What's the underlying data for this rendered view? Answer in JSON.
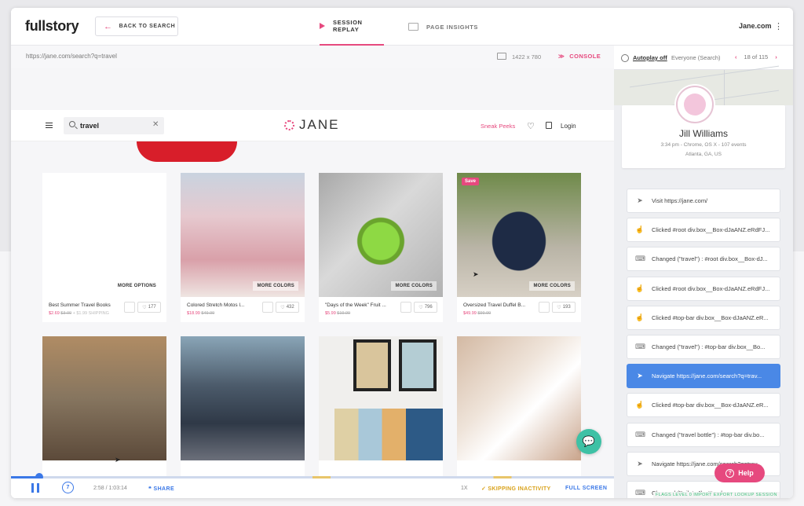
{
  "app": {
    "logo": "fullstory",
    "back_label": "BACK TO SEARCH",
    "tabs": [
      {
        "label": "SESSION REPLAY",
        "active": true
      },
      {
        "label": "PAGE INSIGHTS",
        "active": false
      }
    ],
    "site_name": "Jane.com",
    "kebab": "⋮"
  },
  "player": {
    "url": "https://jane.com/search?q=travel",
    "resolution": "1422 x 780",
    "console_label": "CONSOLE"
  },
  "site": {
    "search_value": "travel",
    "brand": "JANE",
    "sneak_peeks": "Sneak Peeks",
    "login": "Login",
    "products": [
      {
        "title": "Best Summer Travel Books",
        "price": "$2.69",
        "old_price": "$3.00",
        "extra": "+ $1.99 SHIPPING",
        "likes": "177",
        "overlay": "MORE OPTIONS",
        "img": "img1"
      },
      {
        "title": "Colored Stretch Motos l...",
        "price": "$18.99",
        "old_price": "$49.99",
        "extra": "",
        "likes": "432",
        "overlay": "MORE COLORS",
        "img": "img2"
      },
      {
        "title": "\"Days of the Week\" Fruit ...",
        "price": "$5.99",
        "old_price": "$19.99",
        "extra": "",
        "likes": "796",
        "overlay": "MORE COLORS",
        "img": "img3"
      },
      {
        "title": "Oversized Travel Duffel B...",
        "price": "$49.99",
        "old_price": "$99.99",
        "extra": "",
        "likes": "193",
        "overlay": "MORE COLORS",
        "img": "img4",
        "badge": "Save"
      }
    ],
    "chat_icon": "💬"
  },
  "controls": {
    "time": "2:58 / 1:03:14",
    "share": "SHARE",
    "speed": "1X",
    "skipping": "SKIPPING INACTIVITY",
    "fullscreen": "FULL SCREEN",
    "skip_seconds": "7",
    "progress_fraction": 0.047
  },
  "panel": {
    "autoplay": "Autoplay off",
    "segment": "Everyone (Search)",
    "pager": "18 of 115",
    "user": {
      "name": "Jill Williams",
      "meta": "3:34 pm - Chrome, OS X - 107 events",
      "location": "Atlanta,  GA,  US"
    },
    "events": [
      {
        "icon": "navigate-icon",
        "glyph": "➤",
        "text": "Visit https://jane.com/",
        "active": false
      },
      {
        "icon": "click-icon",
        "glyph": "☝",
        "text": "Clicked #root div.box__Box-dJaANZ.eRdFJ...",
        "active": false
      },
      {
        "icon": "keyboard-icon",
        "glyph": "⌨",
        "text": "Changed (\"travel\") : #root div.box__Box-dJ...",
        "active": false
      },
      {
        "icon": "click-icon",
        "glyph": "☝",
        "text": "Clicked #root div.box__Box-dJaANZ.eRdFJ...",
        "active": false
      },
      {
        "icon": "click-icon",
        "glyph": "☝",
        "text": "Clicked #top-bar div.box__Box-dJaANZ.eR...",
        "active": false
      },
      {
        "icon": "keyboard-icon",
        "glyph": "⌨",
        "text": "Changed (\"travel\") : #top-bar div.box__Bo...",
        "active": false
      },
      {
        "icon": "navigate-icon",
        "glyph": "➤",
        "text": "Navigate https://jane.com/search?q=trav...",
        "active": true
      },
      {
        "icon": "click-icon",
        "glyph": "☝",
        "text": "Clicked #top-bar div.box__Box-dJaANZ.eR...",
        "active": false
      },
      {
        "icon": "keyboard-icon",
        "glyph": "⌨",
        "text": "Changed (\"travel bottle\") : #top-bar div.bo...",
        "active": false
      },
      {
        "icon": "navigate-icon",
        "glyph": "➤",
        "text": "Navigate https://jane.com/search?q=trav...",
        "active": false
      },
      {
        "icon": "keyboard-icon",
        "glyph": "⌨",
        "text": "Changed (\"toiletry\") : #top-b...",
        "active": false
      }
    ]
  },
  "help": {
    "label": "Help",
    "glyph": "?"
  },
  "flags": "FLAGS  LEVEL 0  IMPORT  EXPORT  LOOKUP SESSION",
  "colors": {
    "accent": "#e6497e",
    "blue": "#3b78e7",
    "teal": "#3ec1a5"
  }
}
